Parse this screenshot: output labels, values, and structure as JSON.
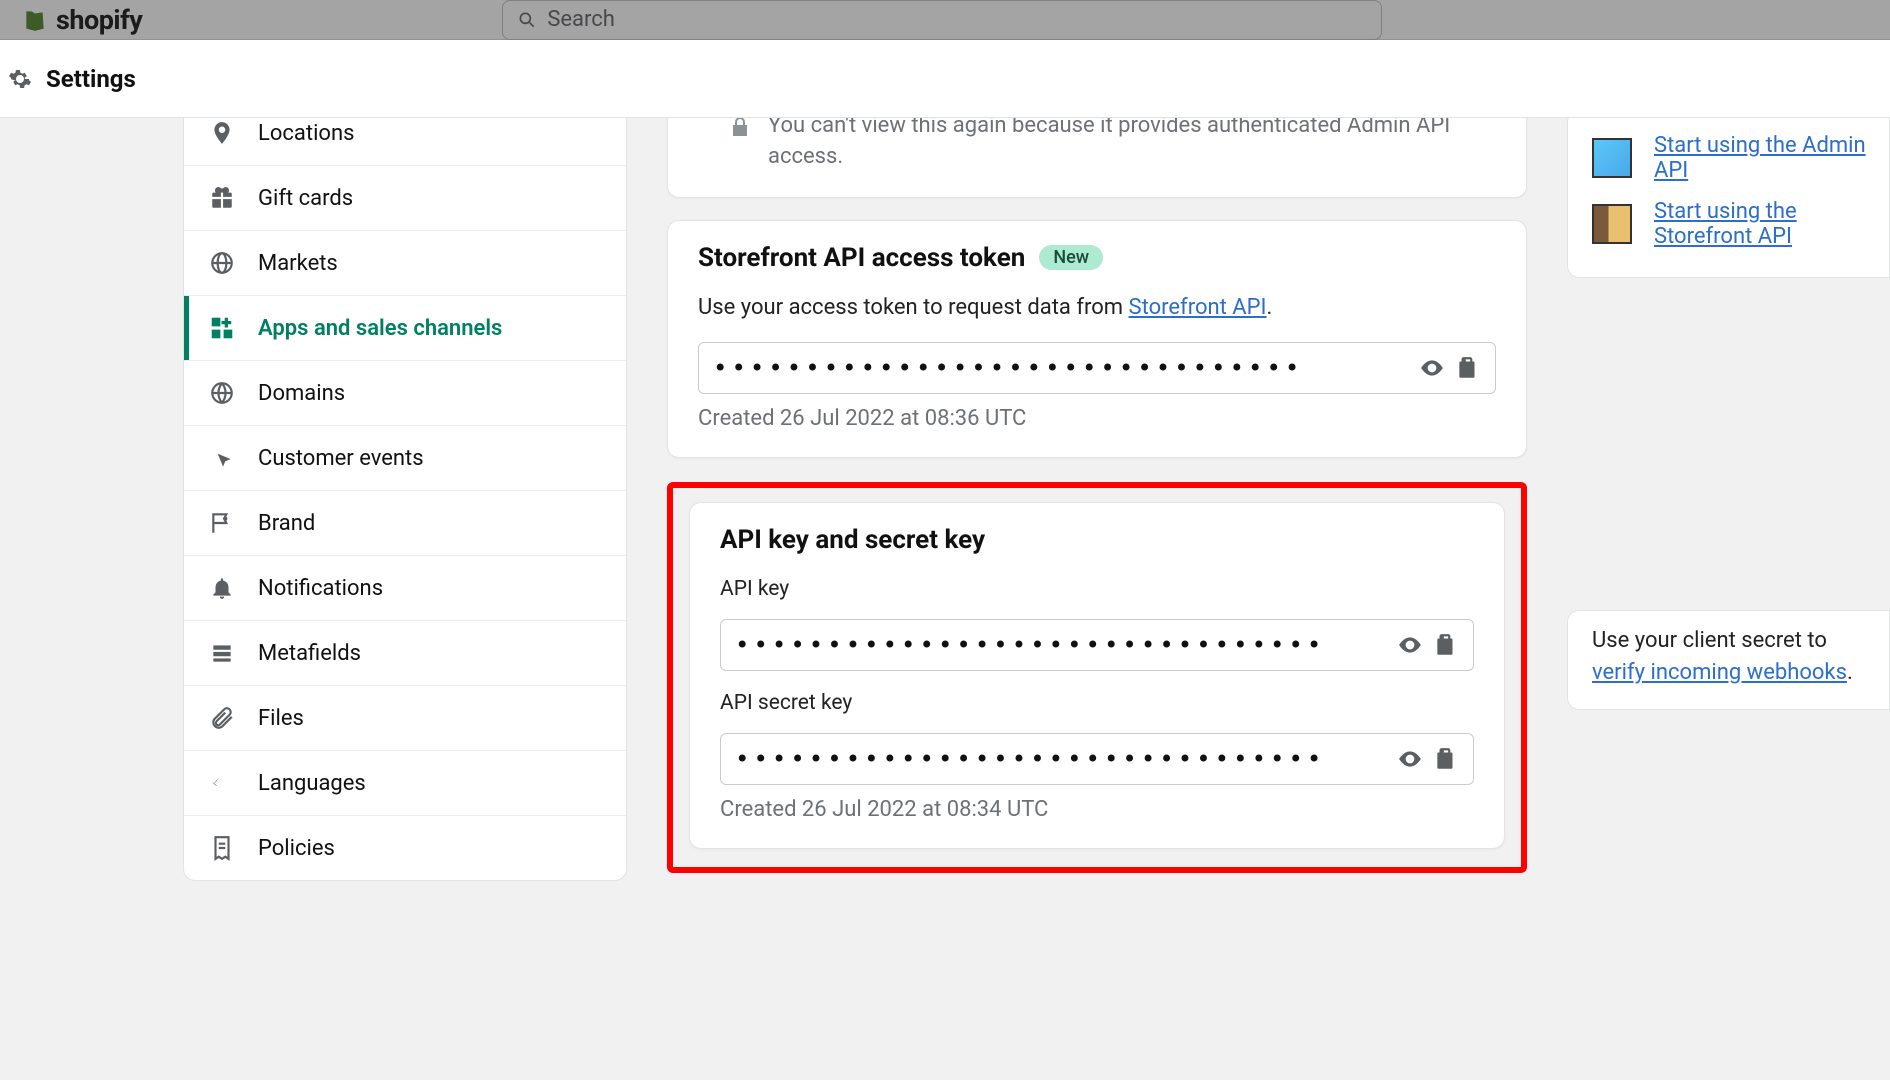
{
  "top": {
    "brand": "shopify",
    "search_placeholder": "Search"
  },
  "settings_label": "Settings",
  "sidebar": {
    "items": [
      {
        "label": "Locations"
      },
      {
        "label": "Gift cards"
      },
      {
        "label": "Markets"
      },
      {
        "label": "Apps and sales channels"
      },
      {
        "label": "Domains"
      },
      {
        "label": "Customer events"
      },
      {
        "label": "Brand"
      },
      {
        "label": "Notifications"
      },
      {
        "label": "Metafields"
      },
      {
        "label": "Files"
      },
      {
        "label": "Languages"
      },
      {
        "label": "Policies"
      }
    ]
  },
  "admin_warning": "You can't view this again because it provides authenticated Admin API access.",
  "storefront": {
    "title": "Storefront API access token",
    "badge": "New",
    "desc_prefix": "Use your access token to request data from ",
    "link_text": "Storefront API",
    "desc_suffix": ".",
    "token_masked": "••••••••••••••••••••••••••••••••",
    "created": "Created 26 Jul 2022 at 08:36 UTC"
  },
  "keys": {
    "title": "API key and secret key",
    "api_key_label": "API key",
    "api_key_masked": "••••••••••••••••••••••••••••••••",
    "secret_label": "API secret key",
    "secret_masked": "••••••••••••••••••••••••••••••••",
    "created": "Created 26 Jul 2022 at 08:34 UTC"
  },
  "right": {
    "admin_link": "Start using the Admin API",
    "storefront_link": "Start using the Storefront API",
    "secret_prefix": "Use your client secret to ",
    "secret_link": "verify incoming webhooks",
    "secret_suffix": "."
  }
}
